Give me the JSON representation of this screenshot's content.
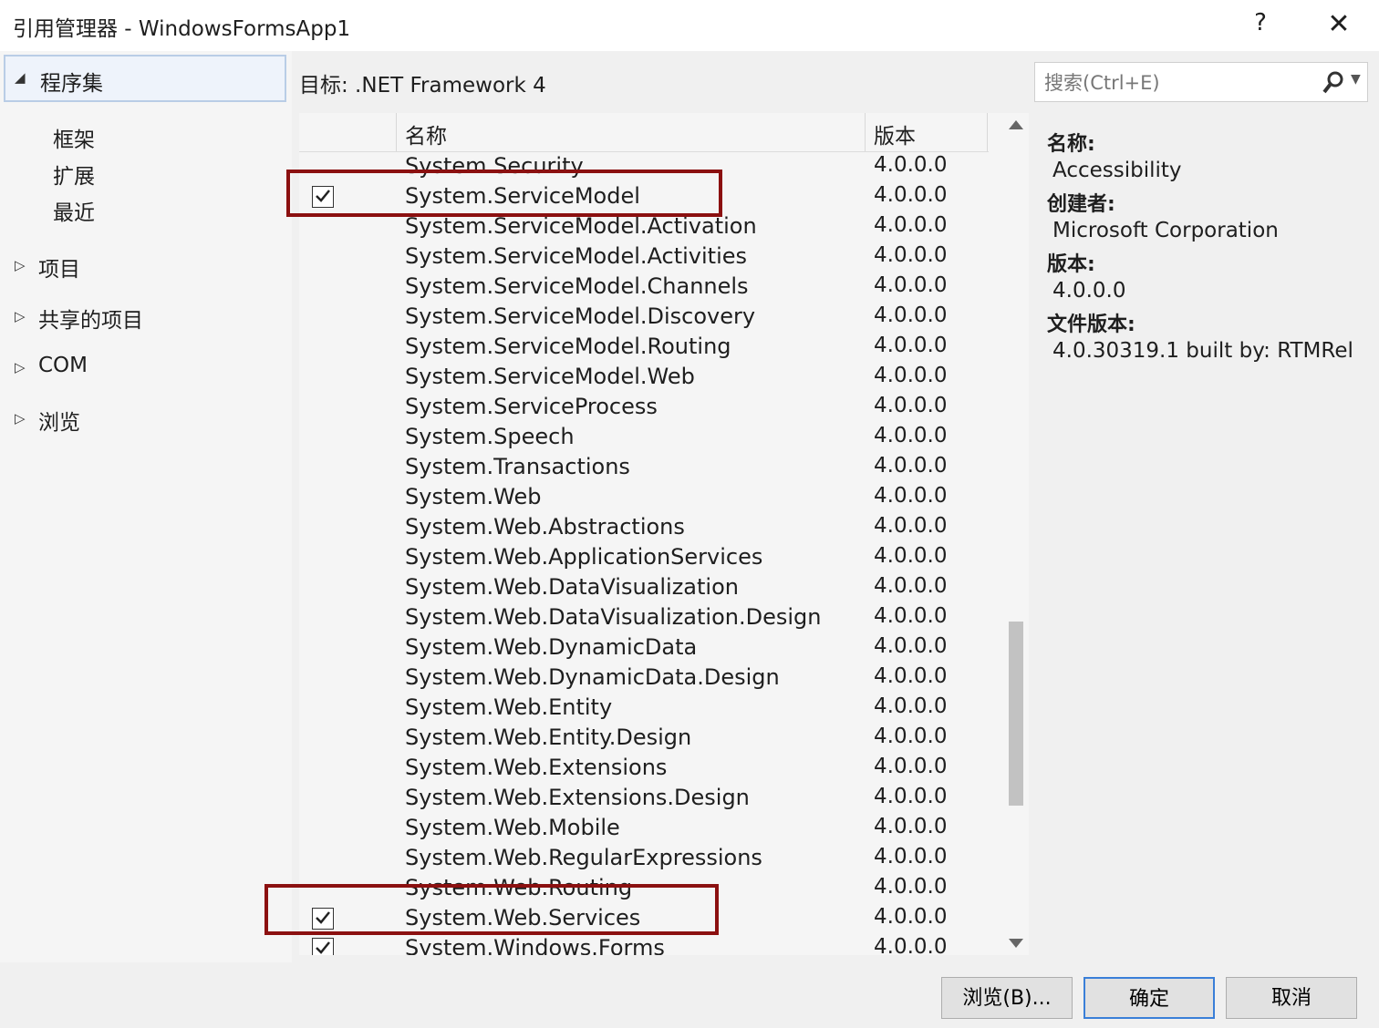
{
  "window": {
    "title": "引用管理器 - WindowsFormsApp1",
    "help": "?",
    "close": "✕"
  },
  "nav": {
    "selected": "程序集",
    "sub_items": [
      "框架",
      "扩展",
      "最近"
    ],
    "groups": [
      "项目",
      "共享的项目",
      "COM",
      "浏览"
    ]
  },
  "target": "目标: .NET Framework 4",
  "search": {
    "placeholder": "搜索(Ctrl+E)"
  },
  "grid": {
    "col_name": "名称",
    "col_version": "版本",
    "rows": [
      {
        "name": "System.Security",
        "version": "4.0.0.0",
        "checked": false
      },
      {
        "name": "System.ServiceModel",
        "version": "4.0.0.0",
        "checked": true
      },
      {
        "name": "System.ServiceModel.Activation",
        "version": "4.0.0.0",
        "checked": false
      },
      {
        "name": "System.ServiceModel.Activities",
        "version": "4.0.0.0",
        "checked": false
      },
      {
        "name": "System.ServiceModel.Channels",
        "version": "4.0.0.0",
        "checked": false
      },
      {
        "name": "System.ServiceModel.Discovery",
        "version": "4.0.0.0",
        "checked": false
      },
      {
        "name": "System.ServiceModel.Routing",
        "version": "4.0.0.0",
        "checked": false
      },
      {
        "name": "System.ServiceModel.Web",
        "version": "4.0.0.0",
        "checked": false
      },
      {
        "name": "System.ServiceProcess",
        "version": "4.0.0.0",
        "checked": false
      },
      {
        "name": "System.Speech",
        "version": "4.0.0.0",
        "checked": false
      },
      {
        "name": "System.Transactions",
        "version": "4.0.0.0",
        "checked": false
      },
      {
        "name": "System.Web",
        "version": "4.0.0.0",
        "checked": false
      },
      {
        "name": "System.Web.Abstractions",
        "version": "4.0.0.0",
        "checked": false
      },
      {
        "name": "System.Web.ApplicationServices",
        "version": "4.0.0.0",
        "checked": false
      },
      {
        "name": "System.Web.DataVisualization",
        "version": "4.0.0.0",
        "checked": false
      },
      {
        "name": "System.Web.DataVisualization.Design",
        "version": "4.0.0.0",
        "checked": false
      },
      {
        "name": "System.Web.DynamicData",
        "version": "4.0.0.0",
        "checked": false
      },
      {
        "name": "System.Web.DynamicData.Design",
        "version": "4.0.0.0",
        "checked": false
      },
      {
        "name": "System.Web.Entity",
        "version": "4.0.0.0",
        "checked": false
      },
      {
        "name": "System.Web.Entity.Design",
        "version": "4.0.0.0",
        "checked": false
      },
      {
        "name": "System.Web.Extensions",
        "version": "4.0.0.0",
        "checked": false
      },
      {
        "name": "System.Web.Extensions.Design",
        "version": "4.0.0.0",
        "checked": false
      },
      {
        "name": "System.Web.Mobile",
        "version": "4.0.0.0",
        "checked": false
      },
      {
        "name": "System.Web.RegularExpressions",
        "version": "4.0.0.0",
        "checked": false
      },
      {
        "name": "System.Web.Routing",
        "version": "4.0.0.0",
        "checked": false
      },
      {
        "name": "System.Web.Services",
        "version": "4.0.0.0",
        "checked": true
      },
      {
        "name": "System.Windows.Forms",
        "version": "4.0.0.0",
        "checked": true
      }
    ]
  },
  "details": {
    "name_label": "名称:",
    "name_value": "Accessibility",
    "creator_label": "创建者:",
    "creator_value": "Microsoft Corporation",
    "version_label": "版本:",
    "version_value": "4.0.0.0",
    "file_version_label": "文件版本:",
    "file_version_value": "4.0.30319.1 built by: RTMRel"
  },
  "buttons": {
    "browse": "浏览(B)...",
    "ok": "确定",
    "cancel": "取消"
  },
  "colors": {
    "highlight_box": "#8b1010",
    "primary_button_border": "#3a7fd8"
  }
}
